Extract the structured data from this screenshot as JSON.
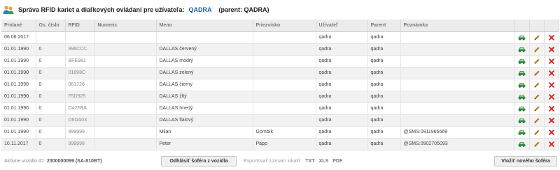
{
  "header": {
    "title": "Správa RFID kariet a diaľkových ovládaní pre užívateľa:",
    "user": "QADRA",
    "parent": "(parent: QADRA)"
  },
  "columns": [
    "Pridané",
    "Os. číslo",
    "RFID",
    "Numeric",
    "Meno",
    "Priezvisko",
    "Užívateľ",
    "Parent",
    "Poznámka"
  ],
  "rows": [
    {
      "added": "06.06.2017",
      "os": "",
      "rfid": "",
      "numeric": "",
      "name": "",
      "surname": "",
      "user": "qadra",
      "parent": "qadra",
      "note": ""
    },
    {
      "added": "01.01.1990",
      "os": "0",
      "rfid": "996CCC",
      "numeric": "",
      "name": "DALLAS červený",
      "surname": "",
      "user": "qadra",
      "parent": "qadra",
      "note": ""
    },
    {
      "added": "01.01.1990",
      "os": "0",
      "rfid": "BFE981",
      "numeric": "",
      "name": "DALLAS modrý",
      "surname": "",
      "user": "qadra",
      "parent": "qadra",
      "note": ""
    },
    {
      "added": "01.01.1990",
      "os": "0",
      "rfid": "01898C",
      "numeric": "",
      "name": "DALLAS zelený",
      "surname": "",
      "user": "qadra",
      "parent": "qadra",
      "note": ""
    },
    {
      "added": "01.01.1990",
      "os": "0",
      "rfid": "061726",
      "numeric": "",
      "name": "DALLAS čierny",
      "surname": "",
      "user": "qadra",
      "parent": "qadra",
      "note": ""
    },
    {
      "added": "01.01.1990",
      "os": "0",
      "rfid": "F5D925",
      "numeric": "",
      "name": "DALLAS žltý",
      "surname": "",
      "user": "qadra",
      "parent": "qadra",
      "note": ""
    },
    {
      "added": "01.01.1990",
      "os": "0",
      "rfid": "D42FBA",
      "numeric": "",
      "name": "DALLAS hnedý",
      "surname": "",
      "user": "qadra",
      "parent": "qadra",
      "note": ""
    },
    {
      "added": "01.01.1990",
      "os": "0",
      "rfid": "D6DA03",
      "numeric": "",
      "name": "DALLAS fialový",
      "surname": "",
      "user": "qadra",
      "parent": "qadra",
      "note": ""
    },
    {
      "added": "01.01.1990",
      "os": "0",
      "rfid": "999999",
      "numeric": "",
      "name": "Milan",
      "surname": "Gombík",
      "user": "qadra",
      "parent": "qadra",
      "note": "@SMS:0911966669"
    },
    {
      "added": "10.11.2017",
      "os": "0",
      "rfid": "999998",
      "numeric": "",
      "name": "Peter",
      "surname": "Papp",
      "user": "qadra",
      "parent": "qadra",
      "note": "@SMS:0902705093"
    }
  ],
  "icons": {
    "car": "car-icon",
    "edit": "pencil-icon",
    "delete": "delete-x-icon",
    "header": "users-icon"
  },
  "colors": {
    "car": "#2e8b3e",
    "pencil": "#b8741a",
    "delete": "#d42020",
    "user_link": "#1f5fa8"
  },
  "footer": {
    "active_label": "Aktívne vozidlo ID:",
    "active_value": "2300000099 (SA-810BT)",
    "unassign_button": "Odhlásiť šoféra z vozidla",
    "export_label": "Exportovať zoznam lokalit:",
    "export_formats": [
      "TXT",
      "XLS",
      "PDF"
    ],
    "add_button": "Vložiť nového šoféra"
  }
}
